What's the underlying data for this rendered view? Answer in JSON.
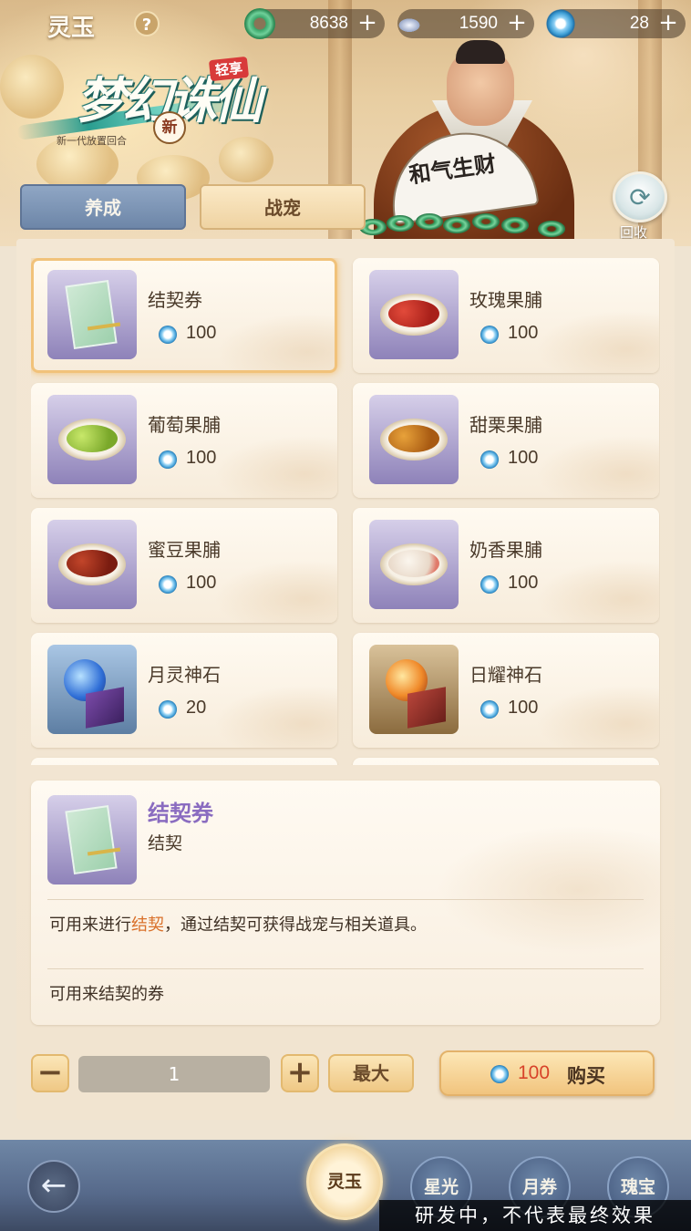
{
  "header": {
    "title": "灵玉",
    "help_label": "?",
    "currencies": [
      {
        "icon": "jade-ring-icon",
        "value": "8638",
        "plus": "+"
      },
      {
        "icon": "silver-ingot-icon",
        "value": "1590",
        "plus": "+"
      },
      {
        "icon": "blue-jade-icon",
        "value": "28",
        "plus": "+"
      }
    ]
  },
  "logo": {
    "main": "梦幻诛仙",
    "tag": "轻享",
    "seal": "新",
    "subtitle": "新一代放置回合"
  },
  "merchant": {
    "fan_text": "和气生财"
  },
  "recycle": {
    "label": "回收",
    "icon": "recycle-icon"
  },
  "tabs": [
    {
      "label": "养成",
      "active": false
    },
    {
      "label": "战宠",
      "active": true
    }
  ],
  "items": [
    {
      "name": "结契券",
      "price": "100",
      "art": "ticket",
      "selected": true
    },
    {
      "name": "玫瑰果脯",
      "price": "100",
      "art": "bowl-red"
    },
    {
      "name": "葡萄果脯",
      "price": "100",
      "art": "bowl-green"
    },
    {
      "name": "甜栗果脯",
      "price": "100",
      "art": "bowl-chestnut"
    },
    {
      "name": "蜜豆果脯",
      "price": "100",
      "art": "bowl-bean"
    },
    {
      "name": "奶香果脯",
      "price": "100",
      "art": "bowl-milk"
    },
    {
      "name": "月灵神石",
      "price": "20",
      "art": "moon-stone"
    },
    {
      "name": "日耀神石",
      "price": "100",
      "art": "sun-stone"
    }
  ],
  "detail": {
    "name": "结契券",
    "type": "结契",
    "desc_pre": "可用来进行",
    "desc_highlight": "结契",
    "desc_post": "，通过结契可获得战宠与相关道具。",
    "note": "可用来结契的券"
  },
  "purchase": {
    "minus": "−",
    "quantity": "1",
    "plus": "+",
    "max_label": "最大",
    "buy_price": "100",
    "buy_label": "购买"
  },
  "bottom_nav": {
    "back_icon": "back-arrow-icon",
    "items": [
      {
        "label": "灵玉",
        "active": true
      },
      {
        "label": "星光",
        "active": false
      },
      {
        "label": "月券",
        "active": false
      },
      {
        "label": "瑰宝",
        "active": false
      }
    ]
  },
  "watermark": "研发中，不代表最终效果",
  "colors": {
    "accent_purple": "#8a6cc0",
    "highlight_orange": "#d9702a",
    "price_red": "#d8432a",
    "tab_active_bg": "#f5dfb4",
    "tab_inactive_bg": "#7e96b6"
  }
}
